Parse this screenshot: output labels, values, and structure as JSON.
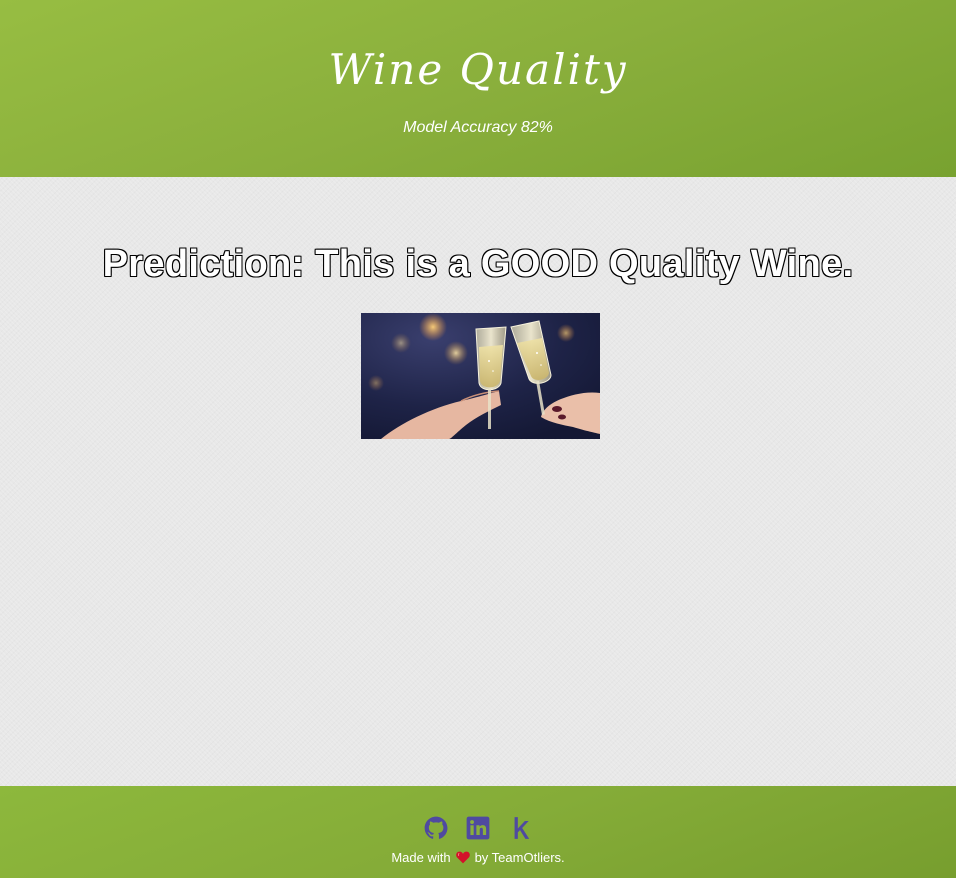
{
  "header": {
    "title": "Wine Quality",
    "subtitle": "Model Accuracy 82%"
  },
  "main": {
    "prediction": "Prediction: This is a GOOD Quality Wine.",
    "image_icon": "champagne-toast-photo"
  },
  "footer": {
    "icons": [
      "github-icon",
      "linkedin-icon",
      "kaggle-icon"
    ],
    "made_with": "Made with",
    "by_team": "by TeamOtliers.",
    "heart_icon": "heart-icon"
  },
  "colors": {
    "header_green": "#8aaf3c",
    "footer_green": "#85ac38",
    "icon_purple": "#4f4aa0",
    "heart_red": "#d3122a"
  }
}
